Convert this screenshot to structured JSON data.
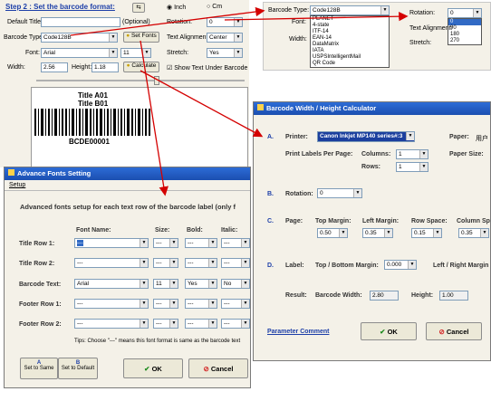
{
  "main_panel": {
    "step_title": "Step 2 : Set the barcode format:",
    "default_title_label": "Default Title:",
    "optional_label": "(Optional)",
    "barcode_type_label": "Barcode Type:",
    "barcode_type_value": "Code128B",
    "set_fonts_button": "Set Fonts",
    "font_label": "Font:",
    "font_value": "Arial",
    "font_size_value": "11",
    "width_label": "Width:",
    "width_value": "2.56",
    "height_label": "Height:",
    "height_value": "1.18",
    "calculate_button": "Calculate",
    "unit_inch": "Inch",
    "unit_cm": "Cm",
    "rotation_label": "Rotation:",
    "rotation_value": "0",
    "text_alignment_label": "Text Alignment:",
    "text_alignment_value": "Center",
    "stretch_label": "Stretch:",
    "stretch_value": "Yes",
    "show_text_label": "Show Text Under Barcode",
    "preview_title1": "Title A01",
    "preview_title2": "Title B01",
    "preview_code": "BCDE00001"
  },
  "type_popup": {
    "barcode_type_label": "Barcode Type:",
    "barcode_type_value": "Code128B",
    "font_label": "Font:",
    "width_label": "Width:",
    "options": [
      "PLANET",
      "4-state",
      "ITF-14",
      "EAN-14",
      "DataMatrix",
      "IATA",
      "USPSIntelligentMail",
      "QR Code"
    ],
    "rotation_label": "Rotation:",
    "rotation_value": "0",
    "rotation_options": [
      "0",
      "90",
      "180",
      "270"
    ],
    "text_alignment_label": "Text Alignment:",
    "stretch_label": "Stretch:"
  },
  "calculator": {
    "title": "Barcode Width / Height Calculator",
    "a_label": "A.",
    "printer_label": "Printer:",
    "printer_value": "Canon Inkjet MP140 series#:3",
    "paper_label": "Paper:",
    "paper_value": "用户",
    "labels_per_page": "Print Labels Per Page:",
    "columns_label": "Columns:",
    "columns_value": "1",
    "rows_label": "Rows:",
    "rows_value": "1",
    "paper_size_label": "Paper Size:",
    "b_label": "B.",
    "rotation_label": "Rotation:",
    "rotation_value": "0",
    "c_label": "C.",
    "page_label": "Page:",
    "top_margin_label": "Top Margin:",
    "top_margin_value": "0.50",
    "left_margin_label": "Left Margin:",
    "left_margin_value": "0.35",
    "row_space_label": "Row Space:",
    "row_space_value": "0.15",
    "column_space_label": "Column Sp",
    "column_space_value": "0.35",
    "d_label": "D.",
    "label_label": "Label:",
    "top_bottom_label": "Top / Bottom Margin:",
    "top_bottom_value": "0.000",
    "left_right_label": "Left / Right Margin",
    "result_label": "Result:",
    "barcode_width_label": "Barcode Width:",
    "barcode_width_value": "2.80",
    "height_label": "Height:",
    "height_value": "1.00",
    "param_comment": "Parameter Comment",
    "ok_button": "OK",
    "cancel_button": "Cancel"
  },
  "fonts_dialog": {
    "title": "Advance Fonts Setting",
    "menu_setup": "Setup",
    "description": "Advanced fonts setup for each text row of the barcode label (only f",
    "col_font_name": "Font Name:",
    "col_size": "Size:",
    "col_bold": "Bold:",
    "col_italic": "Italic:",
    "rows": [
      {
        "label": "Title Row 1:",
        "font": "---",
        "size": "---",
        "bold": "---",
        "italic": "---"
      },
      {
        "label": "Title Row 2:",
        "font": "---",
        "size": "---",
        "bold": "---",
        "italic": "---"
      },
      {
        "label": "Barcode Text:",
        "font": "Arial",
        "size": "11",
        "bold": "Yes",
        "italic": "No"
      },
      {
        "label": "Footer Row 1:",
        "font": "---",
        "size": "---",
        "bold": "---",
        "italic": "---"
      },
      {
        "label": "Footer Row 2:",
        "font": "---",
        "size": "---",
        "bold": "---",
        "italic": "---"
      }
    ],
    "tips": "Tips:  Choose \"---\" means this font format is same as the barcode text",
    "set_same_button": "Set to Same",
    "set_default_button": "Set to Default",
    "ok_button": "OK",
    "cancel_button": "Cancel"
  }
}
